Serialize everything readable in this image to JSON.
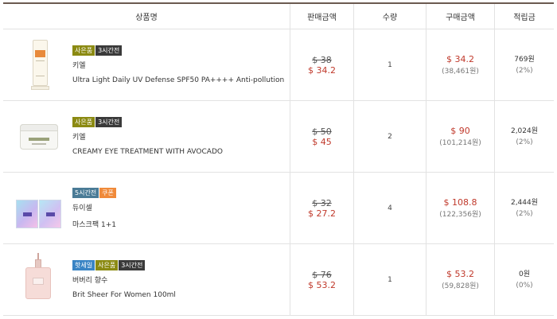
{
  "table": {
    "headers": {
      "product": "상품명",
      "price": "판매금액",
      "qty": "수량",
      "total": "구매금액",
      "points": "적립금"
    },
    "rows": [
      {
        "badges": [
          {
            "text": "사은품",
            "kind": "gift"
          },
          {
            "text": "3시간전",
            "kind": "time"
          }
        ],
        "brand": "키엘",
        "name": "Ultra Light Daily UV Defense SPF50 PA++++ Anti-pollution",
        "original_price": "$ 38",
        "sale_price": "$ 34.2",
        "quantity": "1",
        "total_usd": "$ 34.2",
        "total_krw": "(38,461원)",
        "points": "769원",
        "points_rate": "(2%)",
        "image_icon": "sunscreen-tube-icon"
      },
      {
        "badges": [
          {
            "text": "사은품",
            "kind": "gift"
          },
          {
            "text": "3시간전",
            "kind": "time"
          }
        ],
        "brand": "키엘",
        "name": "CREAMY EYE TREATMENT WITH AVOCADO",
        "original_price": "$ 50",
        "sale_price": "$ 45",
        "quantity": "2",
        "total_usd": "$ 90",
        "total_krw": "(101,214원)",
        "points": "2,024원",
        "points_rate": "(2%)",
        "image_icon": "cream-jar-icon"
      },
      {
        "badges": [
          {
            "text": "5시간전",
            "kind": "time-blue"
          },
          {
            "text": "쿠폰",
            "kind": "coupon"
          }
        ],
        "brand": "듀이셀",
        "name": "마스크팩 1+1",
        "original_price": "$ 32",
        "sale_price": "$ 27.2",
        "quantity": "4",
        "total_usd": "$ 108.8",
        "total_krw": "(122,356원)",
        "points": "2,444원",
        "points_rate": "(2%)",
        "image_icon": "mask-pack-icon"
      },
      {
        "badges": [
          {
            "text": "핫세일",
            "kind": "hot"
          },
          {
            "text": "사은품",
            "kind": "gift"
          },
          {
            "text": "3시간전",
            "kind": "time"
          }
        ],
        "brand": "버버리 향수",
        "name": "Brit Sheer For Women 100ml",
        "original_price": "$ 76",
        "sale_price": "$ 53.2",
        "quantity": "1",
        "total_usd": "$ 53.2",
        "total_krw": "(59,828원)",
        "points": "0원",
        "points_rate": "(0%)",
        "image_icon": "perfume-bottle-icon"
      }
    ]
  },
  "colors": {
    "accent_red": "#c0392b",
    "header_border": "#6b5a50",
    "badge_gift": "#8b8a12",
    "badge_time": "#3a3a3a",
    "badge_time_blue": "#4a7b96",
    "badge_coupon": "#f08a3a",
    "badge_hot": "#3a84c4"
  }
}
